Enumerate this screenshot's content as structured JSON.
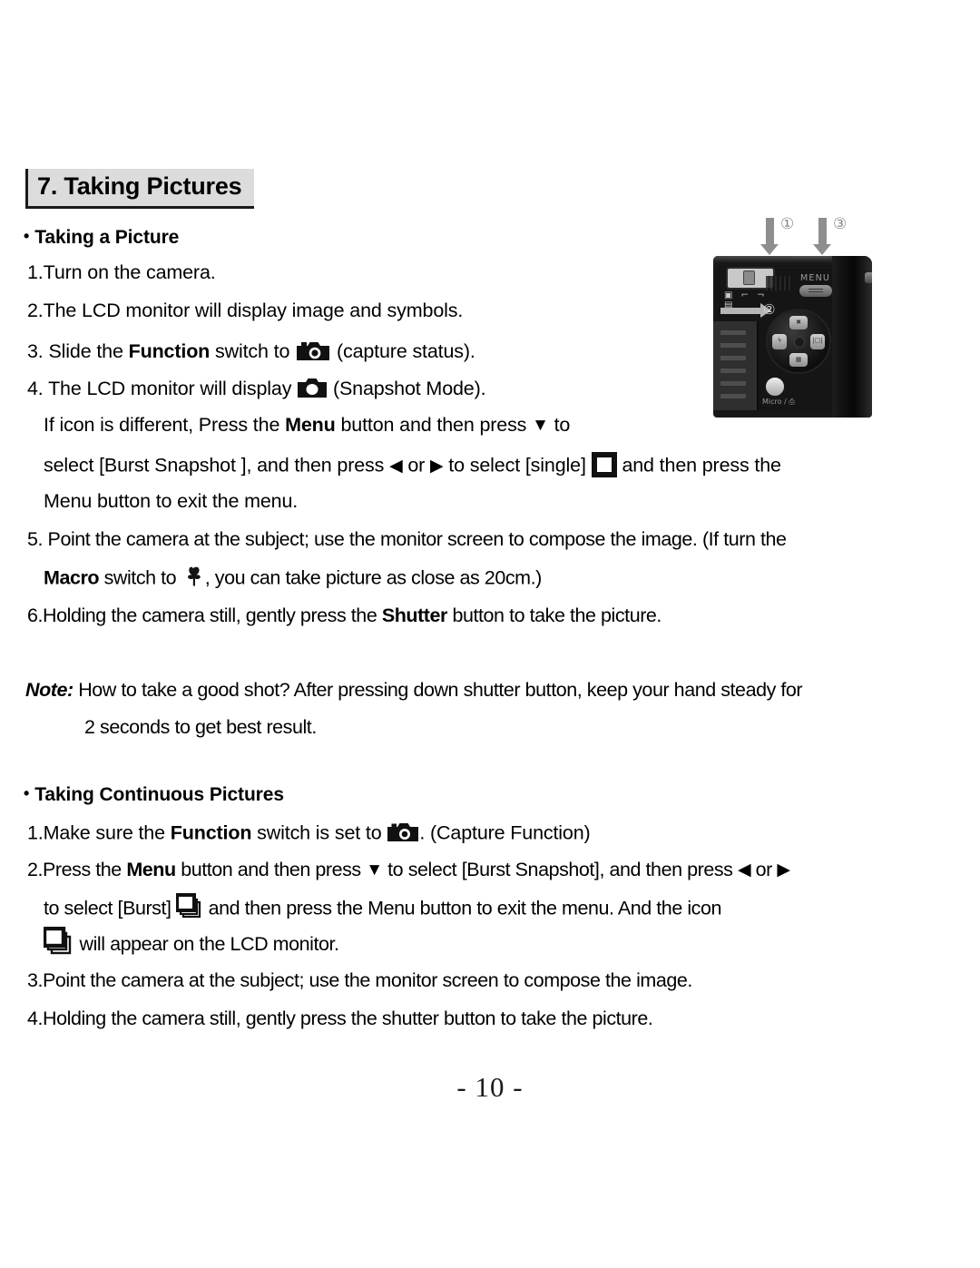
{
  "document": {
    "section_title": "7. Taking Pictures",
    "page_number": "- 10 -"
  },
  "section_taking_a_picture": {
    "heading": "Taking a Picture",
    "bullet": "•",
    "steps": {
      "s1": "1.Turn on the camera.",
      "s2": "2.The LCD monitor will display image and symbols.",
      "s3_a": "3. Slide the ",
      "s3_b": "Function",
      "s3_c": " switch to",
      "s3_d": "(capture status).",
      "s4_a": "4. The LCD monitor will display",
      "s4_d": "(Snapshot Mode).",
      "s4_l2_a": "If icon is different, Press the ",
      "s4_l2_b": "Menu",
      "s4_l2_c": " button and then press ",
      "s4_l2_tri": "▼",
      "s4_l2_d": " to",
      "s4_l3_a": "select [Burst Snapshot ], and then press ",
      "s4_l3_left": "◀",
      "s4_l3_b": " or ",
      "s4_l3_right": "▶",
      "s4_l3_c": " to select [single]",
      "s4_l3_d": "and then press the",
      "s4_l4": "Menu button to exit the menu.",
      "s5_l1": "5. Point the camera at the subject; use the monitor screen to compose the image. (If turn the",
      "s5_l2_a": "Macro",
      "s5_l2_b": " switch to",
      "s5_l2_c": ", you can take picture as close as 20cm.)",
      "s6_a": "6.Holding the camera still, gently press the ",
      "s6_b": "Shutter",
      "s6_c": " button to take the picture."
    }
  },
  "note": {
    "label": "Note:",
    "line1": " How to take a good shot? After pressing down shutter button, keep your hand steady for",
    "line2": "2 seconds to get best result."
  },
  "section_continuous": {
    "heading": "Taking Continuous Pictures",
    "bullet": "•",
    "steps": {
      "c1_a": "1.Make sure the ",
      "c1_b": "Function",
      "c1_c": " switch is set to",
      "c1_d": ". (Capture Function)",
      "c2_l1_a": "2.Press the ",
      "c2_l1_b": "Menu",
      "c2_l1_c": " button and then press ",
      "c2_l1_tri": "▼",
      "c2_l1_d": " to select [Burst Snapshot], and then press ",
      "c2_l1_left": "◀",
      "c2_l1_e": " or ",
      "c2_l1_right": "▶",
      "c2_l2_a": "to select [Burst]",
      "c2_l2_b": "and then press the Menu button to exit the menu. And the icon",
      "c2_l3": "will appear on the LCD monitor.",
      "c3": "3.Point the camera at the subject; use the monitor screen to compose the image.",
      "c4": "4.Holding the camera still, gently press the shutter button to take the picture."
    }
  },
  "camera_photo": {
    "callout_1": "①",
    "callout_2": "②",
    "callout_3": "③",
    "menu_label": "MENU",
    "mode_marks": "▣ ⌐ ¬ ▤",
    "micro_label": "Micro / ⎙",
    "dpad": {
      "up": "✖",
      "left": "ϟ",
      "right": "|▢|",
      "down": "▦"
    }
  }
}
